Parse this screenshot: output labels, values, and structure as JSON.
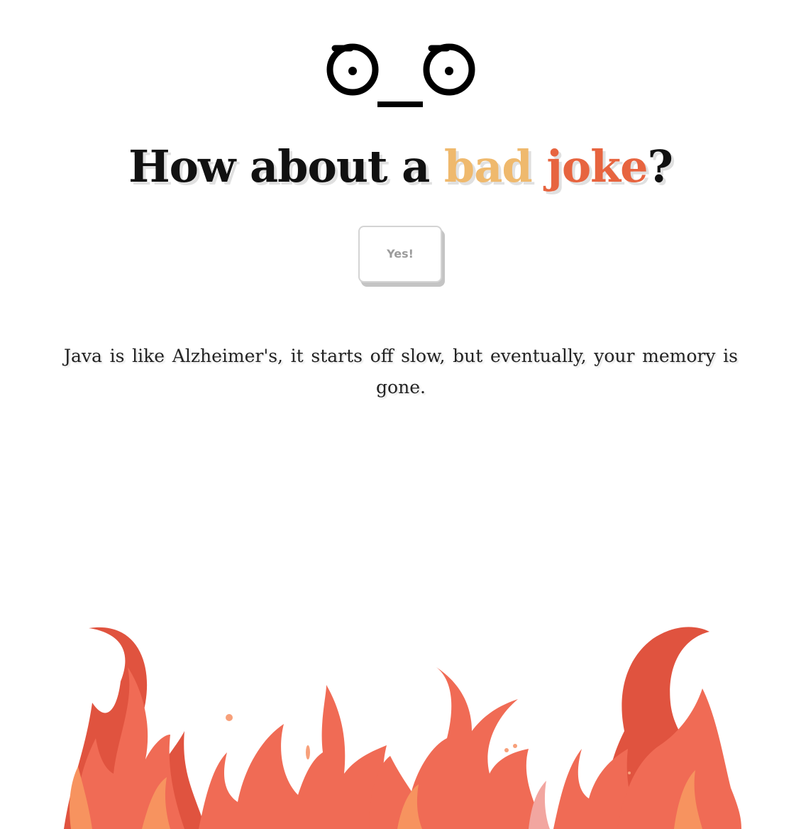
{
  "face": {
    "emoticon": "ಠ_ಠ"
  },
  "headline": {
    "prefix": "How about a ",
    "word_bad": "bad",
    "space": " ",
    "word_joke": "joke",
    "suffix": "?"
  },
  "button": {
    "label": "Yes!"
  },
  "joke": {
    "text": "Java is like Alzheimer's, it starts off slow, but eventually, your memory is gone."
  },
  "colors": {
    "accent_bad": "#efb96d",
    "accent_joke": "#e7643f",
    "flame_dark": "#e0533f",
    "flame_mid": "#f06b55",
    "flame_light": "#f7935f",
    "flame_pink": "#f2a6a0"
  },
  "icons": {
    "face": "disapproval-face-icon",
    "fire": "fire-illustration"
  }
}
